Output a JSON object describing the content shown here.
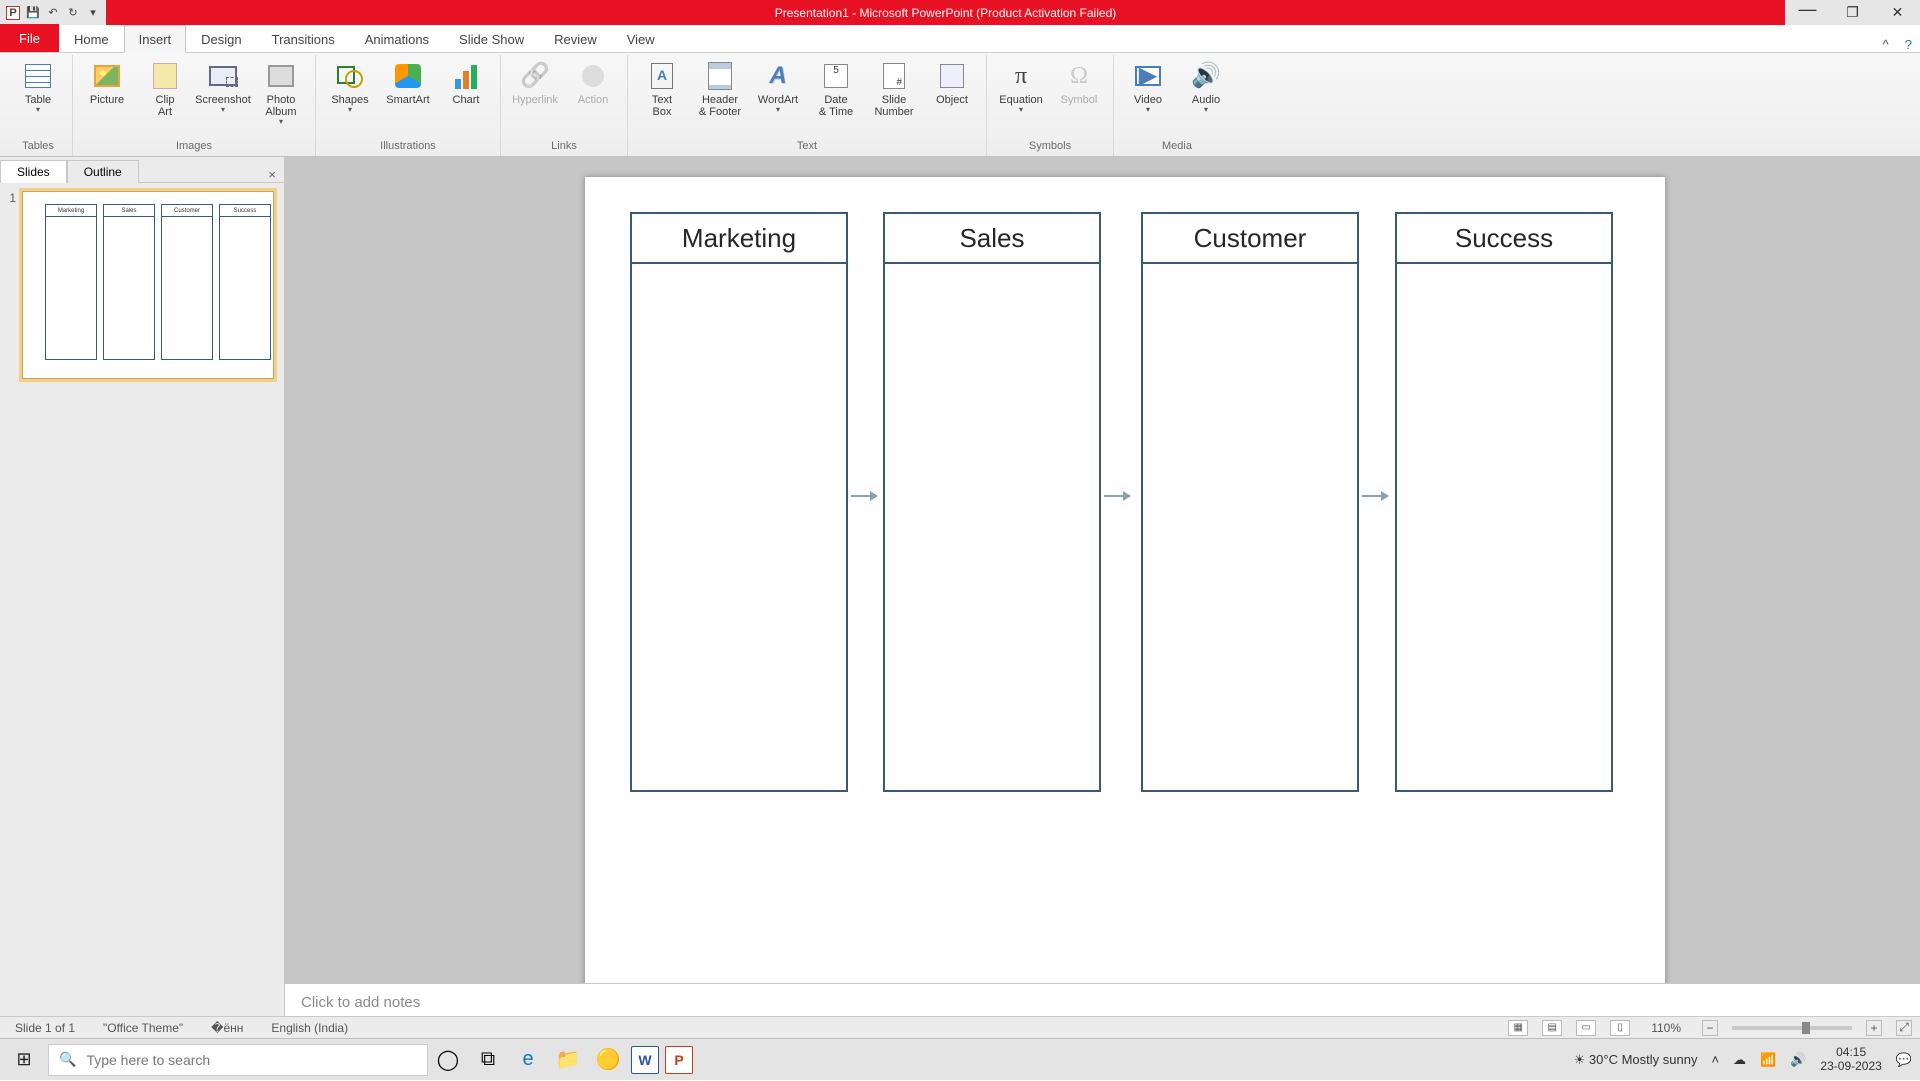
{
  "app": {
    "title": "Presentation1 - Microsoft PowerPoint (Product Activation Failed)"
  },
  "qat": {
    "save": "💾",
    "undo": "↶",
    "redo": "↻"
  },
  "tabs": {
    "file": "File",
    "home": "Home",
    "insert": "Insert",
    "design": "Design",
    "transitions": "Transitions",
    "animations": "Animations",
    "slideshow": "Slide Show",
    "review": "Review",
    "view": "View"
  },
  "ribbon": {
    "tables": {
      "name": "Tables",
      "table": "Table"
    },
    "images": {
      "name": "Images",
      "picture": "Picture",
      "clipart": "Clip\nArt",
      "screenshot": "Screenshot",
      "album": "Photo\nAlbum"
    },
    "illus": {
      "name": "Illustrations",
      "shapes": "Shapes",
      "smartart": "SmartArt",
      "chart": "Chart"
    },
    "links": {
      "name": "Links",
      "hyperlink": "Hyperlink",
      "action": "Action"
    },
    "text": {
      "name": "Text",
      "textbox": "Text\nBox",
      "hdr": "Header\n& Footer",
      "wordart": "WordArt",
      "dt": "Date\n& Time",
      "sn": "Slide\nNumber",
      "obj": "Object"
    },
    "symbols": {
      "name": "Symbols",
      "eq": "Equation",
      "sym": "Symbol"
    },
    "media": {
      "name": "Media",
      "video": "Video",
      "audio": "Audio"
    }
  },
  "slidepanel": {
    "tab_slides": "Slides",
    "tab_outline": "Outline",
    "thumb_num": "1",
    "thumb_cols": [
      "Marketing",
      "Sales",
      "Customer",
      "Success"
    ]
  },
  "slide": {
    "cols": [
      "Marketing",
      "Sales",
      "Customer",
      "Success"
    ]
  },
  "notes": {
    "placeholder": "Click to add notes"
  },
  "status": {
    "slide": "Slide 1 of 1",
    "theme": "\"Office Theme\"",
    "lang": "English (India)",
    "zoom": "110%"
  },
  "taskbar": {
    "search_placeholder": "Type here to search",
    "weather": "30°C  Mostly sunny",
    "time": "04:15",
    "date": "23-09-2023"
  }
}
